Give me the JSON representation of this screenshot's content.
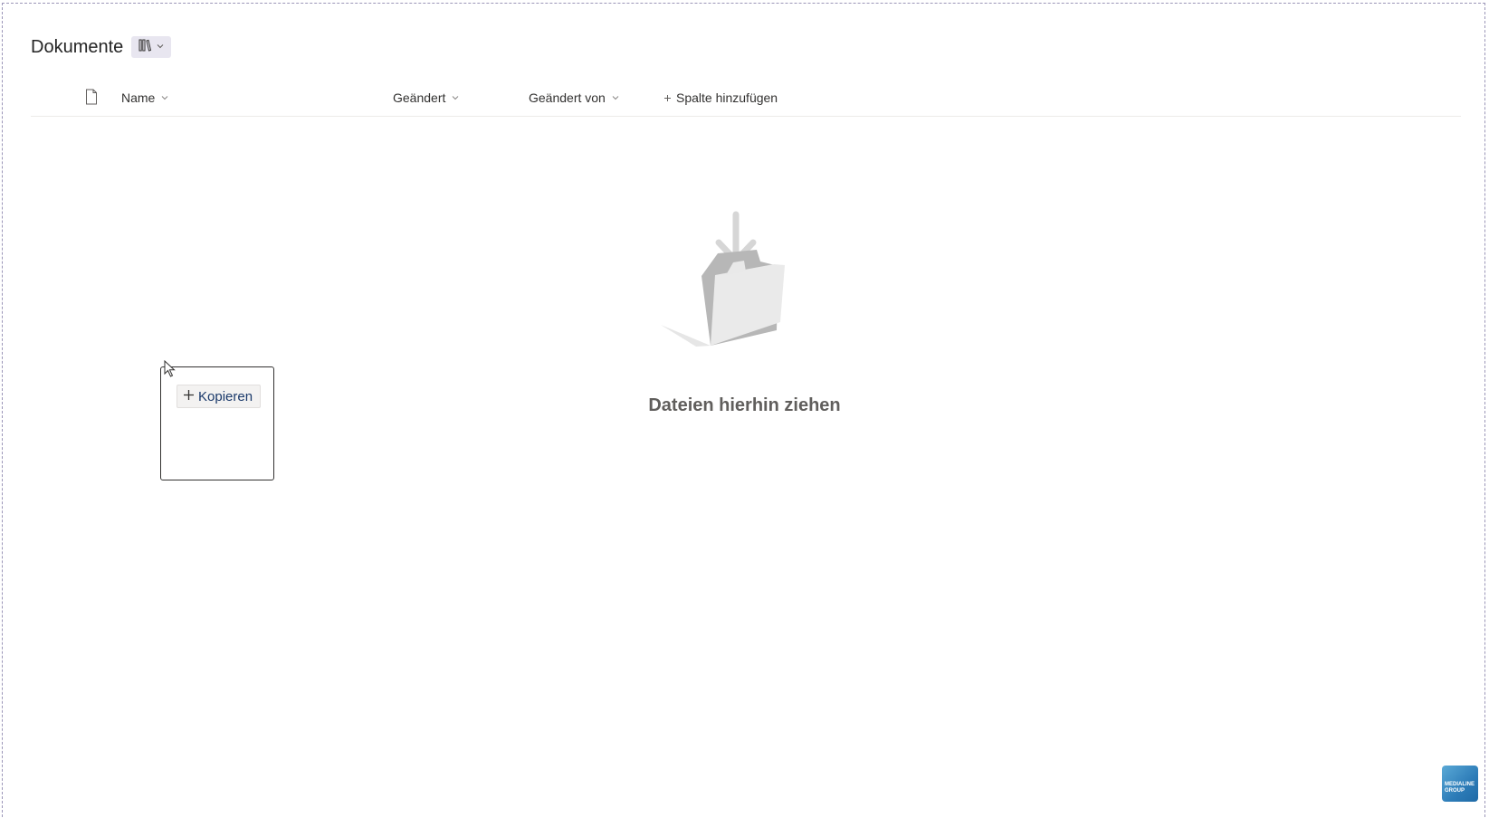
{
  "library": {
    "title": "Dokumente"
  },
  "columns": [
    {
      "label": "Name"
    },
    {
      "label": "Geändert"
    },
    {
      "label": "Geändert von"
    }
  ],
  "add_column": {
    "label": "Spalte hinzufügen"
  },
  "empty_state": {
    "message": "Dateien hierhin ziehen"
  },
  "drag": {
    "action_label": "Kopieren"
  },
  "logo": {
    "line1": "MEDIALINE",
    "line2": "GROUP"
  },
  "colors": {
    "accent": "#1b3a6b",
    "frame_dash": "#9b96b8",
    "view_switch_bg": "#e8e6f0",
    "empty_text": "#605e5c"
  },
  "icons": {
    "view_switch": "library-view-icon",
    "file_type": "document-icon",
    "sort": "chevron-down-icon",
    "add": "plus-icon",
    "empty": "folder-drop-icon",
    "cursor": "mouse-pointer-icon"
  }
}
